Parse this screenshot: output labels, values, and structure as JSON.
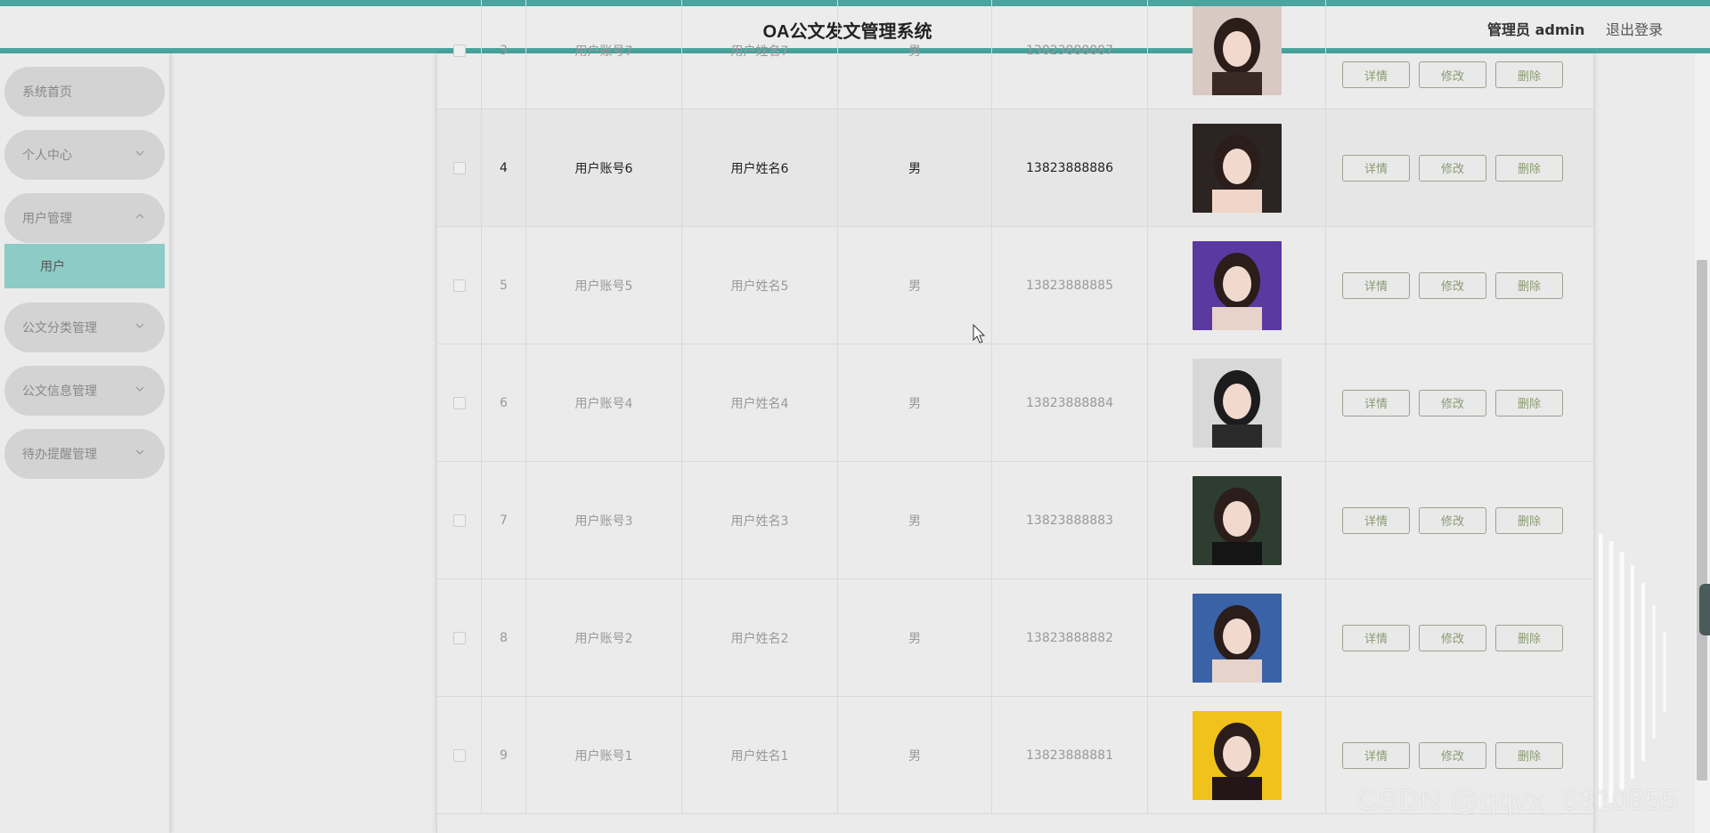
{
  "header": {
    "title": "OA公文发文管理系统",
    "user_label": "管理员 admin",
    "logout": "退出登录"
  },
  "sidebar": {
    "items": [
      {
        "label": "系统首页",
        "expandable": false
      },
      {
        "label": "个人中心",
        "expandable": true,
        "expanded": false
      },
      {
        "label": "用户管理",
        "expandable": true,
        "expanded": true
      },
      {
        "label": "公文分类管理",
        "expandable": true,
        "expanded": false
      },
      {
        "label": "公文信息管理",
        "expandable": true,
        "expanded": false
      },
      {
        "label": "待办提醒管理",
        "expandable": true,
        "expanded": false
      }
    ],
    "active_sub": "用户"
  },
  "table": {
    "rows": [
      {
        "index": "3",
        "account": "用户账号7",
        "name": "用户姓名7",
        "sex": "男",
        "phone": "13823888887"
      },
      {
        "index": "4",
        "account": "用户账号6",
        "name": "用户姓名6",
        "sex": "男",
        "phone": "13823888886",
        "highlighted": true
      },
      {
        "index": "5",
        "account": "用户账号5",
        "name": "用户姓名5",
        "sex": "男",
        "phone": "13823888885"
      },
      {
        "index": "6",
        "account": "用户账号4",
        "name": "用户姓名4",
        "sex": "男",
        "phone": "13823888884"
      },
      {
        "index": "7",
        "account": "用户账号3",
        "name": "用户姓名3",
        "sex": "男",
        "phone": "13823888883"
      },
      {
        "index": "8",
        "account": "用户账号2",
        "name": "用户姓名2",
        "sex": "男",
        "phone": "13823888882"
      },
      {
        "index": "9",
        "account": "用户账号1",
        "name": "用户姓名1",
        "sex": "男",
        "phone": "13823888881"
      }
    ],
    "actions": {
      "detail": "详情",
      "edit": "修改",
      "delete": "删除"
    }
  },
  "watermark": "CSDN @qqvx_6310855",
  "colors": {
    "accent": "#4aa59e",
    "submenu_active": "#8ccbc6",
    "button_text": "#8a9a70"
  }
}
